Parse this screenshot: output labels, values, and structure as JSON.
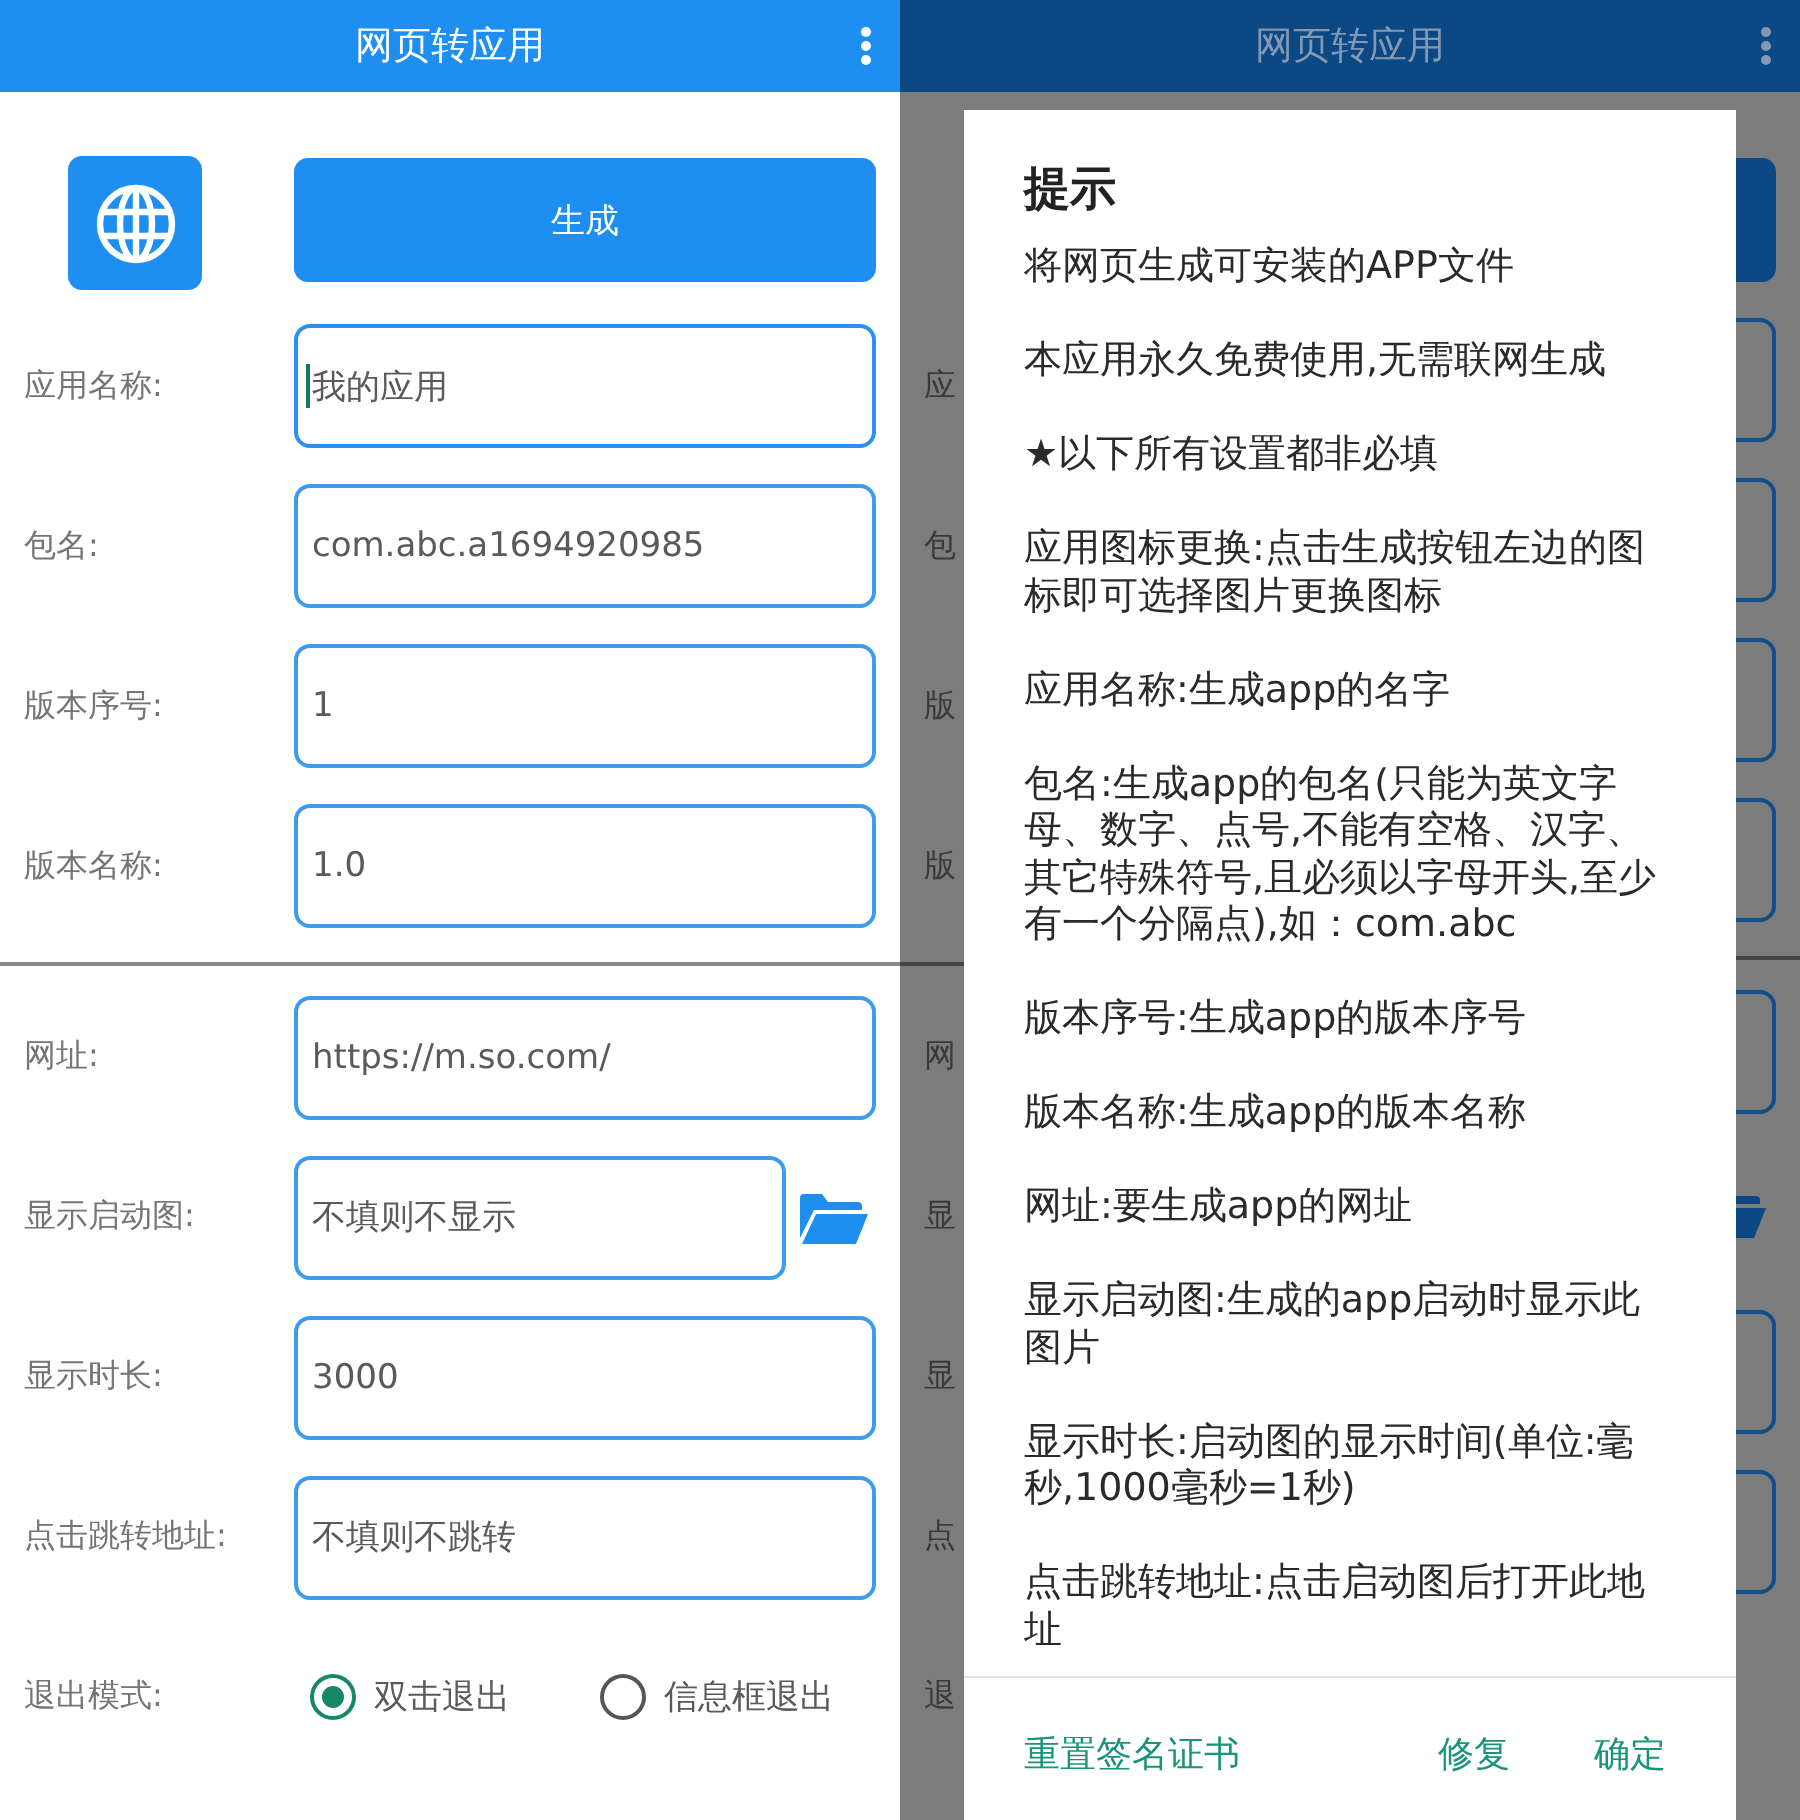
{
  "screens": [
    {
      "app_bar": {
        "title": "网页转应用"
      },
      "generate_button": "生成",
      "sections": [
        {
          "fields": [
            {
              "label": "应用名称:",
              "value": "我的应用",
              "kind": "text",
              "focused": true
            },
            {
              "label": "包名:",
              "value": "com.abc.a1694920985",
              "kind": "text",
              "focused": false
            },
            {
              "label": "版本序号:",
              "value": "1",
              "kind": "text",
              "focused": false
            },
            {
              "label": "版本名称:",
              "value": "1.0",
              "kind": "text",
              "focused": false
            }
          ]
        },
        {
          "fields": [
            {
              "label": "网址:",
              "value": "https://m.so.com/",
              "kind": "text",
              "focused": false
            },
            {
              "label": "显示启动图:",
              "value": "不填则不显示",
              "kind": "file",
              "focused": false
            },
            {
              "label": "显示时长:",
              "value": "3000",
              "kind": "text",
              "focused": false
            },
            {
              "label": "点击跳转地址:",
              "value": "不填则不跳转",
              "kind": "text",
              "focused": false
            }
          ]
        }
      ],
      "exit_mode": {
        "label": "退出模式:",
        "options": [
          {
            "label": "双击退出",
            "selected": true
          },
          {
            "label": "信息框退出",
            "selected": false
          }
        ]
      }
    },
    {
      "app_bar": {
        "title": "网页转应用"
      },
      "background": {
        "sections": [
          {
            "rows": [
              {
                "label": "应",
                "kind": "field"
              },
              {
                "label": "包",
                "kind": "field"
              },
              {
                "label": "版",
                "kind": "field"
              },
              {
                "label": "版",
                "kind": "field"
              }
            ]
          },
          {
            "rows": [
              {
                "label": "网",
                "kind": "field"
              },
              {
                "label": "显",
                "kind": "file"
              },
              {
                "label": "显",
                "kind": "field"
              },
              {
                "label": "点",
                "kind": "field"
              },
              {
                "label": "退",
                "kind": "radio"
              }
            ]
          }
        ]
      },
      "dialog": {
        "title": "提示",
        "paragraphs": [
          "将网页生成可安装的APP文件",
          "本应用永久免费使用,无需联网生成",
          "★以下所有设置都非必填",
          "应用图标更换:点击生成按钮左边的图标即可选择图片更换图标",
          "应用名称:生成app的名字",
          "包名:生成app的包名(只能为英文字母、数字、点号,不能有空格、汉字、其它特殊符号,且必须以字母开头,至少有一个分隔点),如：com.abc",
          "版本序号:生成app的版本序号",
          "版本名称:生成app的版本名称",
          "网址:要生成app的网址",
          "显示启动图:生成的app启动时显示此图片",
          "显示时长:启动图的显示时间(单位:毫秒,1000毫秒=1秒)",
          "点击跳转地址:点击启动图后打开此地址"
        ],
        "buttons": [
          "重置签名证书",
          "修复",
          "确定"
        ]
      }
    }
  ]
}
